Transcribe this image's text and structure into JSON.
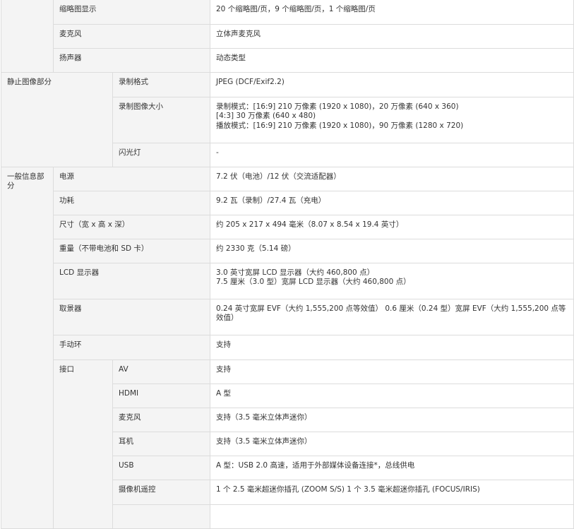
{
  "rows": {
    "thumbnail": {
      "label": "缩略图显示",
      "value": "20 个缩略图/页，9 个缩略图/页，1 个缩略图/页"
    },
    "microphone": {
      "label": "麦克风",
      "value": "立体声麦克风"
    },
    "speaker": {
      "label": "扬声器",
      "value": "动态类型"
    },
    "still_section": {
      "label": "静止图像部分"
    },
    "still_format": {
      "label": "录制格式",
      "value": "JPEG (DCF/Exif2.2)"
    },
    "still_size": {
      "label": "录制图像大小",
      "lines": [
        "录制模式：[16:9] 210 万像素 (1920 x 1080)，20 万像素 (640 x 360)",
        "[4:3] 30 万像素 (640 x 480)",
        "播放模式：[16:9] 210 万像素 (1920 x 1080)，90 万像素 (1280 x 720)"
      ]
    },
    "flash": {
      "label": "闪光灯",
      "value": "-"
    },
    "general_section": {
      "label": "一般信息部分"
    },
    "power": {
      "label": "电源",
      "value": "7.2 伏（电池）/12 伏（交流适配器）"
    },
    "consumption": {
      "label": "功耗",
      "value": "9.2 瓦（录制）/27.4 瓦（充电）"
    },
    "dimensions": {
      "label": "尺寸（宽 x 高 x 深）",
      "value": "约 205 x 217 x 494 毫米（8.07 x 8.54 x 19.4 英寸）"
    },
    "weight": {
      "label": "重量（不带电池和 SD 卡）",
      "value": "约 2330 克（5.14 磅）"
    },
    "lcd": {
      "label": "LCD 显示器",
      "lines": [
        "3.0 英寸宽屏 LCD 显示器（大约 460,800 点）",
        "7.5 厘米（3.0 型）宽屏 LCD 显示器（大约 460,800 点）"
      ]
    },
    "viewfinder": {
      "label": "取景器",
      "value": "0.24 英寸宽屏 EVF（大约 1,555,200 点等效值） 0.6 厘米（0.24 型）宽屏 EVF（大约 1,555,200 点等效值）"
    },
    "manual_ring": {
      "label": "手动环",
      "value": "支持"
    },
    "interface": {
      "label": "接口"
    },
    "av": {
      "label": "AV",
      "value": "支持"
    },
    "hdmi": {
      "label": "HDMI",
      "value": "A 型"
    },
    "mic_jack": {
      "label": "麦克风",
      "value": "支持（3.5 毫米立体声迷你）"
    },
    "headphone": {
      "label": "耳机",
      "value": "支持（3.5 毫米立体声迷你）"
    },
    "usb": {
      "label": "USB",
      "value": "A 型：USB 2.0 高速，适用于外部媒体设备连接*，总线供电"
    },
    "camera_remote": {
      "label": "摄像机遥控",
      "value": "1 个 2.5 毫米超迷你插孔 (ZOOM S/S) 1 个 3.5 毫米超迷你插孔 (FOCUS/IRIS)"
    }
  }
}
